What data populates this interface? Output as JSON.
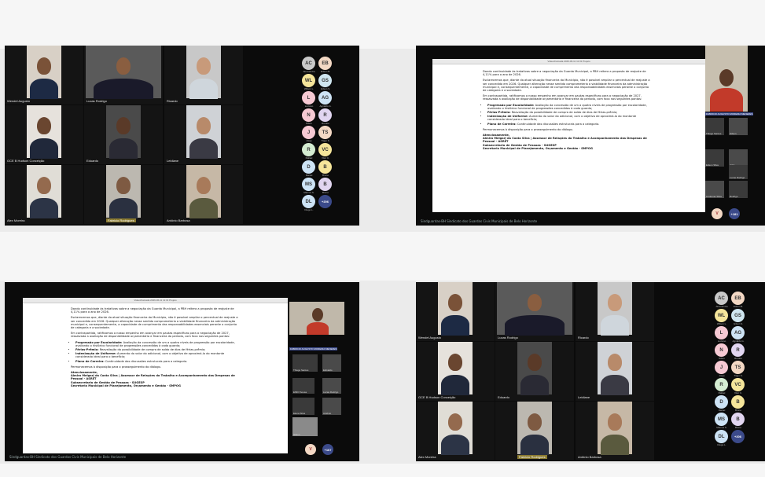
{
  "panels": {
    "grid_top_left": {
      "tiles": [
        {
          "name": "Wendel Augusto",
          "tag": false
        },
        {
          "name": "Lucas Rodrigo",
          "tag": false
        },
        {
          "name": "Ricardo",
          "tag": false
        },
        {
          "name": "GCE B Hudson Conceição",
          "tag": false
        },
        {
          "name": "Eduardo",
          "tag": false
        },
        {
          "name": "Leidiane",
          "tag": false
        },
        {
          "name": "Alex Moreira",
          "tag": false
        },
        {
          "name": "Fabricio Rodrigues",
          "tag": true
        },
        {
          "name": "Antônio Barbosa",
          "tag": false
        }
      ]
    },
    "avatars": [
      {
        "initials": "AC",
        "label": "Alessandra",
        "color": "#c9c9c9"
      },
      {
        "initials": "EB",
        "label": "Edson B.",
        "color": "#f3d8c4"
      },
      {
        "initials": "WL",
        "label": "Wilson L.",
        "color": "#f5e59a"
      },
      {
        "initials": "GS",
        "label": "Gilson S.",
        "color": "#cfe6f0"
      },
      {
        "initials": "L",
        "label": "Luciano",
        "color": "#f6c9d3"
      },
      {
        "initials": "AG",
        "label": "Agnaldo G.",
        "color": "#cde3f5"
      },
      {
        "initials": "N",
        "label": "Nilton",
        "color": "#f6c9d3"
      },
      {
        "initials": "R",
        "label": "Renato",
        "color": "#e1d5f0"
      },
      {
        "initials": "J",
        "label": "Jorge",
        "color": "#f6c9d3"
      },
      {
        "initials": "TS",
        "label": "Tiago S.",
        "color": "#f3d8c4"
      },
      {
        "initials": "R",
        "label": "Rafael",
        "color": "#d4ecd1"
      },
      {
        "initials": "VC",
        "label": "Vitor C.",
        "color": "#f5e59a"
      },
      {
        "initials": "D",
        "label": "Daniel",
        "color": "#cde3f5"
      },
      {
        "initials": "B",
        "label": "Bruno",
        "color": "#f5e59a"
      },
      {
        "initials": "MS",
        "label": "Marcos S.",
        "color": "#cde3f5"
      },
      {
        "initials": "B",
        "label": "Breno",
        "color": "#e1d5f0"
      },
      {
        "initials": "DL",
        "label": "Diego L.",
        "color": "#cde3f5"
      },
      {
        "initials": "+206",
        "label": "",
        "color": "#3b4a8a"
      }
    ],
    "doc": {
      "window_title": "Videochamada 2026-06-11 11:31 Projeto",
      "paragraphs": [
        "Dando continuidade às tratativas sobre a negociação da Guarda Municipal, a PBH reitera a proposta de reajuste de 4,11% para o ano de 2026.",
        "Esclarecemos que, diante da atual situação financeira do Município, não é possível ampliar o percentual de reajuste a ser concedido em 2026. Qualquer alteração nesse sentido comprometeria a viabilidade financeira da administração municipal e, consequentemente, a capacidade de cumprimento das responsabilidades essenciais perante o conjunto de categoria e a sociedade.",
        "Em contrapartida, ratificamos o nosso empenho em avançar em pautas específicas para a negociação de 2027, ressalvada a avaliação de disponibilidade orçamentária e financeira do período, com foco nos seguintes pontos:"
      ],
      "bullets": [
        {
          "title": "Progressão por Escolaridade:",
          "text": "Avaliação da concessão de um a quatro níveis de progressão por escolaridade, avaliando o histórico funcional de progressões concedidas à cada guarda;"
        },
        {
          "title": "Férias-Prêmio:",
          "text": "Reavaliação da possibilidade de compra de saldo de dias de férias-prêmio;"
        },
        {
          "title": "Indenização de Uniforme:",
          "text": "Aumento do valor do adicional, com o objetivo de aproximá-lo do montante considerado ideal para o benefício;"
        },
        {
          "title": "Plano de Carreira:",
          "text": "Continuidade das discussões estruturais para a categoria."
        }
      ],
      "closing": "Permanecemos à disposição para o prosseguimento do diálogo.",
      "signature": [
        "Atenciosamente,",
        "Almiro Meigarj da Costa Silva | Assessor de Relações do Trabalho e Acompanhamento das Despesas de Pessoal - ASRET",
        "Subsecretaria de Gestão de Pessoas - SUGESP",
        "Secretaria Municipal de Planejamento, Orçamento e Gestão - SMPOG"
      ]
    },
    "side_tiles_tr": [
      {
        "name": "Thiago Santos"
      },
      {
        "name": "Gilson"
      },
      {
        "name": "Edson Silva"
      },
      {
        "name": "João"
      },
      {
        "name": "Lucas Rodrigo"
      },
      {
        "name": "Lindomar Silva"
      },
      {
        "name": "Rodrigo"
      }
    ],
    "side_tiles_bl": [
      {
        "name": "Thiago Santos"
      },
      {
        "name": "Edivaldo"
      },
      {
        "name": "EMIO Sousa"
      },
      {
        "name": "Lucas Rodrigo"
      },
      {
        "name": "Elena Silva"
      },
      {
        "name": "Antônio"
      },
      {
        "name": "Gilson"
      }
    ],
    "highlight_label": "FABRICIO AUGUSTO MOREIRA MENEZES",
    "footer": "Sindguardas-BH Sindicato dos Guardas Civis Municipais de Belo Horizonte",
    "v_badge": "V",
    "count_badge_tr": "+181",
    "count_badge_bl": "+167"
  }
}
